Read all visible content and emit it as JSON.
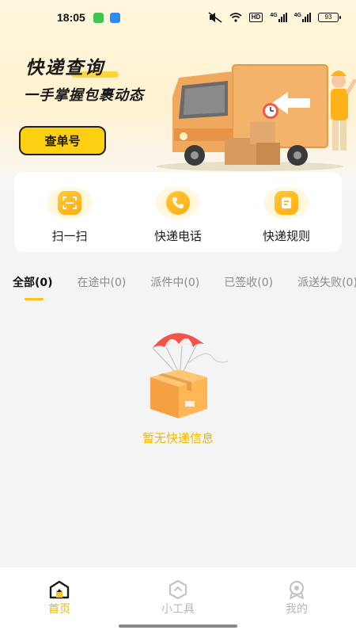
{
  "status_bar": {
    "time": "18:05",
    "network_1": "4G",
    "network_2": "4G",
    "hd_label": "HD",
    "battery": "93"
  },
  "hero": {
    "title": "快递查询",
    "subtitle": "一手掌握包裹动态",
    "query_button_label": "查单号"
  },
  "tools": [
    {
      "label": "扫一扫",
      "icon": "scan-icon"
    },
    {
      "label": "快递电话",
      "icon": "phone-icon"
    },
    {
      "label": "快递规则",
      "icon": "document-icon"
    }
  ],
  "tabs": [
    {
      "label": "全部(0)",
      "active": true
    },
    {
      "label": "在途中(0)",
      "active": false
    },
    {
      "label": "派件中(0)",
      "active": false
    },
    {
      "label": "已签收(0)",
      "active": false
    },
    {
      "label": "派送失败(0)",
      "active": false
    }
  ],
  "empty_state": {
    "text": "暂无快递信息",
    "icon": "parachute-package-icon"
  },
  "bottom_nav": [
    {
      "label": "首页",
      "icon": "home-icon",
      "active": true
    },
    {
      "label": "小工具",
      "icon": "tools-icon",
      "active": false
    },
    {
      "label": "我的",
      "icon": "profile-icon",
      "active": false
    }
  ],
  "colors": {
    "accent": "#ffc21a",
    "accent_text": "#f2b600",
    "background": "#f4f4f4"
  }
}
